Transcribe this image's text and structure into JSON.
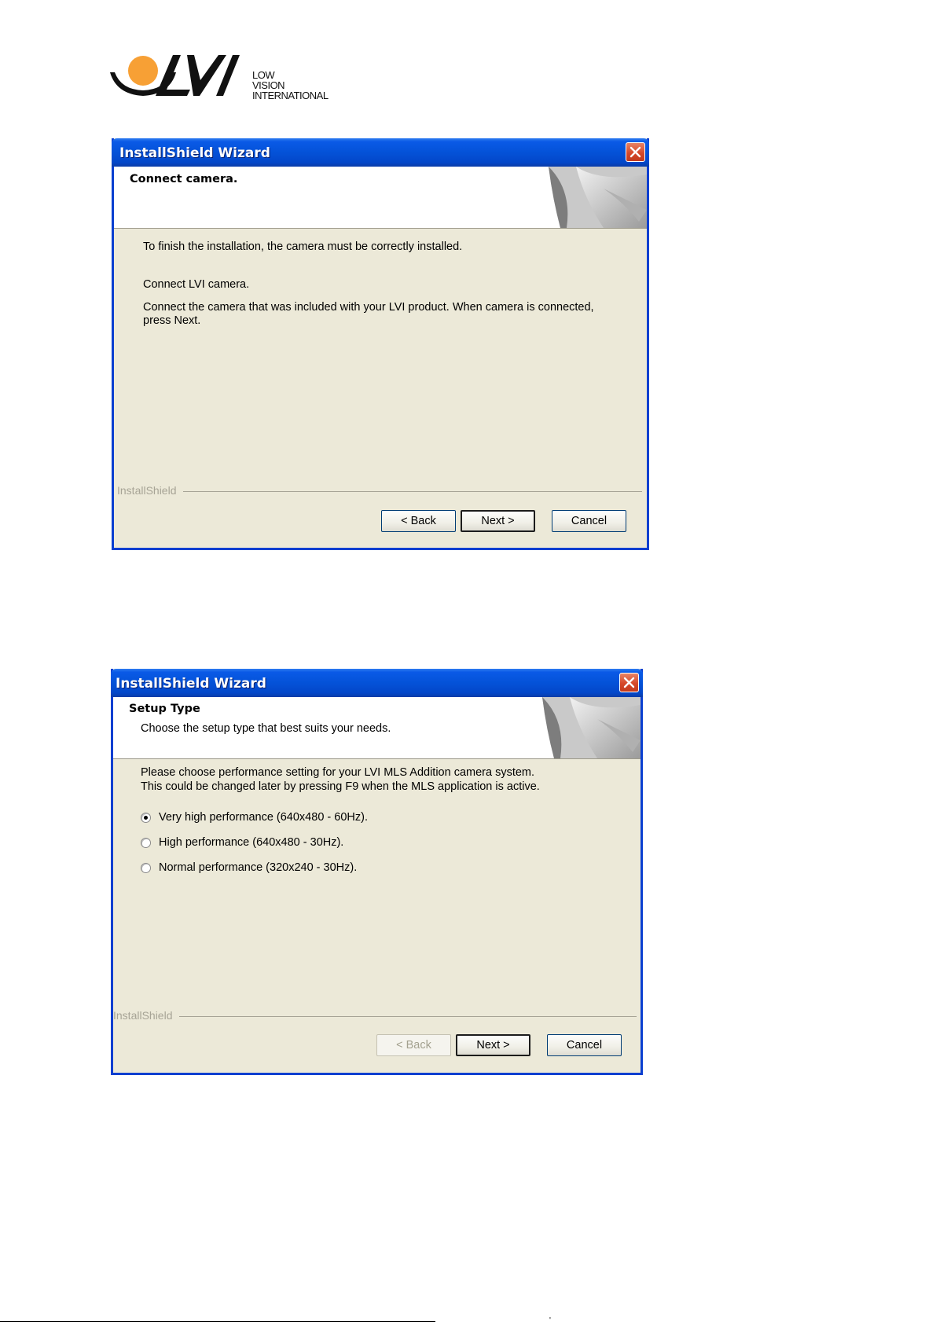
{
  "logo": {
    "lines": [
      "LOW",
      "VISION",
      "INTERNATIONAL"
    ],
    "letters": "LVI",
    "colors": {
      "sun": "#f7a035",
      "mark": "#111111"
    }
  },
  "dialogs": [
    {
      "title": "InstallShield Wizard",
      "header": {
        "title": "Connect camera.",
        "subtitle": ""
      },
      "paragraphs": [
        "To finish the installation, the camera must be correctly installed.",
        "Connect LVI camera.",
        "Connect the camera that was included with your LVI product. When camera is connected,",
        "press Next."
      ],
      "brand": "InstallShield",
      "buttons": {
        "back": "< Back",
        "next": "Next >",
        "cancel": "Cancel"
      },
      "back_enabled": true
    },
    {
      "title": "InstallShield Wizard",
      "header": {
        "title": "Setup Type",
        "subtitle": "Choose the setup type that best suits your needs."
      },
      "paragraphs": [
        "Please choose performance setting for your LVI MLS Addition camera system.",
        "This could be changed later by pressing F9 when the MLS application is active."
      ],
      "options": [
        {
          "label": "Very high performance (640x480 - 60Hz).",
          "checked": true
        },
        {
          "label": "High performance (640x480 - 30Hz).",
          "checked": false
        },
        {
          "label": "Normal performance (320x240 - 30Hz).",
          "checked": false
        }
      ],
      "brand": "InstallShield",
      "buttons": {
        "back": "< Back",
        "next": "Next >",
        "cancel": "Cancel"
      },
      "back_enabled": false
    }
  ],
  "footer": {
    "mark": "'"
  },
  "theme": {
    "titlebar": "#0452d8",
    "window_face": "#ece9d8",
    "close_button": "#d6492a",
    "brand_text": "#a7a496"
  }
}
